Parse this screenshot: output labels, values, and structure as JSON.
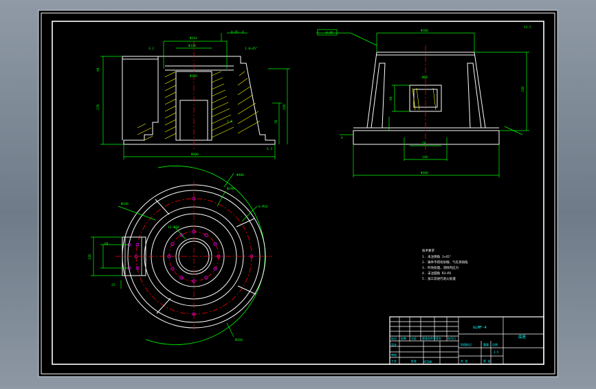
{
  "colors": {
    "viewport": "#000000",
    "outline": "#ffffff",
    "dimension": "#00ff00",
    "center_line": "#ff0000",
    "hatch": "#ffff00",
    "hidden_line": "#ff00ff",
    "title_text": "#00ffff"
  },
  "front_view": {
    "dims": {
      "top_width": "Φ264",
      "bore": "Φ120",
      "inner_bore": "Φ160",
      "base_width": "Φ300",
      "height_total": "270",
      "height_a": "60",
      "height_b": "150",
      "height_c": "70",
      "chamfer": "1.6×45°",
      "flatness": "0.05",
      "datum": "A"
    },
    "roughness": [
      "3.2",
      "1.6",
      "6.3"
    ]
  },
  "side_view": {
    "dims": {
      "top": "Φ180",
      "height": "230",
      "slot": "Φ60",
      "slot_h": "60",
      "base": "Φ300",
      "base_inner": "140",
      "base_h": "50"
    },
    "perpendicularity": "0.05",
    "datum": "A",
    "roughness": "12.5"
  },
  "plan_view": {
    "labels": [
      "Φ400",
      "Φ290",
      "6-M16",
      "12-Φ18",
      "Φ140",
      "Φ260",
      "60",
      "120",
      "25"
    ]
  },
  "notes": {
    "title": "技术要求",
    "items": [
      "1. 未注倒角 1×45°",
      "2. 铸件不得有砂眼、气孔等缺陷",
      "3. 时效处理，消除内应力",
      "4. 未注圆角 R3~R5",
      "5. 加工前进行退火处理"
    ]
  },
  "title_block": {
    "drawing_no": "GLMF-4",
    "part_name": "底座",
    "material": "HT200",
    "scale": "1:5",
    "labels": [
      "标记",
      "处数",
      "分区",
      "更改文件号",
      "签名",
      "年月日",
      "设计",
      "审核",
      "工艺",
      "批准",
      "阶段标记",
      "重量",
      "比例",
      "共  张",
      "第  张"
    ]
  }
}
